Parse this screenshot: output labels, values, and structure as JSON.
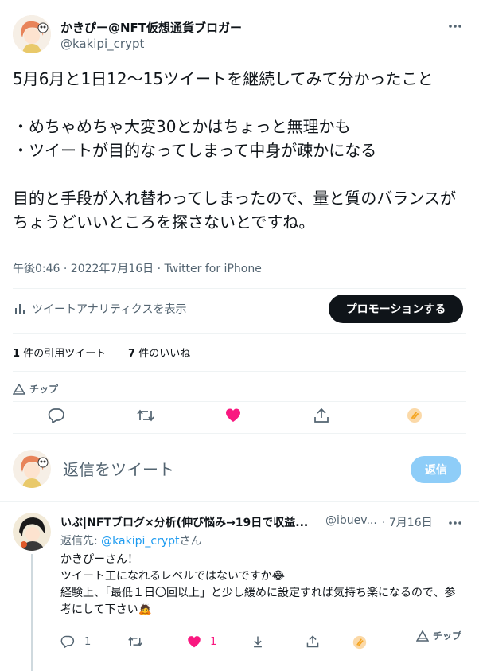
{
  "tweet": {
    "author_name": "かきぴー@NFT仮想通貨ブロガー",
    "author_handle": "@kakipi_crypt",
    "more_label": "…",
    "text": "5月6月と1日12〜15ツイートを継続してみて分かったこと\n\n・めちゃめちゃ大変30とかはちょっと無理かも\n・ツイートが目的なってしまって中身が疎かになる\n\n目的と手段が入れ替わってしまったので、量と質のバランスがちょうどいいところを探さないとですね。",
    "time": "午後0:46 · 2022年7月16日 · Twitter for iPhone",
    "analytics_label": "ツイートアナリティクスを表示",
    "promote_label": "プロモーションする",
    "quote_count": "1",
    "quote_label": "件の引用ツイート",
    "like_count": "7",
    "like_label": "件のいいね",
    "tip_label": "チップ"
  },
  "compose": {
    "placeholder": "返信をツイート",
    "reply_button": "返信"
  },
  "reply": {
    "author_name": "いぶ|NFTブログ×分析(伸び悩み→19日で収益...",
    "author_handle": "@ibuev...",
    "date": "· 7月16日",
    "more_label": "…",
    "replying_prefix": "返信先: ",
    "replying_handle": "@kakipi_crypt",
    "replying_suffix": "さん",
    "text": "かきぴーさん！\nツイート王になれるレベルではないですか😂\n経験上、「最低１日〇回以上」と少し緩めに設定すれば気持ち楽になるので、参考にして下さい🙇",
    "reply_count": "1",
    "like_count": "1",
    "tip_label": "チップ"
  },
  "colors": {
    "accent": "#1d9bf0",
    "like": "#f91880",
    "promote_bg": "#0f1419",
    "reply_button_bg": "#8ecdf8",
    "tip": "#f5a623"
  }
}
